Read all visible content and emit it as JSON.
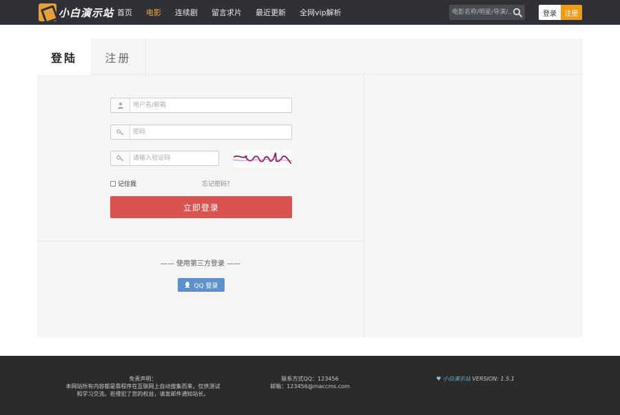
{
  "header": {
    "logo_text": "小白演示站",
    "nav": [
      {
        "label": "首页",
        "active": false
      },
      {
        "label": "电影",
        "active": true
      },
      {
        "label": "连续剧",
        "active": false
      },
      {
        "label": "留言求片",
        "active": false
      },
      {
        "label": "最近更新",
        "active": false
      },
      {
        "label": "全网vip解析",
        "active": false
      }
    ],
    "search": {
      "placeholder": "电影名称/明星/导演/...",
      "icon": "search-icon"
    },
    "login_label": "登录",
    "register_label": "注册"
  },
  "tabs": {
    "login": "登陆",
    "register": "注册"
  },
  "form": {
    "username_placeholder": "用户名/邮箱",
    "password_placeholder": "密码",
    "code_placeholder": "请输入验证码",
    "captcha_icon": "captcha-image",
    "remember_label": "记住我",
    "forgot_label": "忘记密码？",
    "submit_label": "立即登录"
  },
  "third_party": {
    "title": "—— 使用第三方登录 ——",
    "qq_label": "QQ 登录"
  },
  "footer": {
    "disclaimer_title": "免责声明：",
    "disclaimer_line1": "本网站所有内容都是靠程序在互联网上自动搜集而来，仅供测试",
    "disclaimer_line2": "和学习交流。若侵犯了您的权益，请发邮件通知站长。",
    "contact_qq": "联系方式QQ：123456",
    "contact_email": "邮箱：123456@maccms.com",
    "brand": "小白演示站",
    "version": "VERSION: 1.5.1"
  },
  "colors": {
    "header_bg": "#2f3137",
    "nav_active": "#f4a338",
    "register_btn": "#f09a1a",
    "submit_btn": "#d9534f",
    "qq_btn": "#5e91cb",
    "footer_bg": "#2b2b2b"
  }
}
